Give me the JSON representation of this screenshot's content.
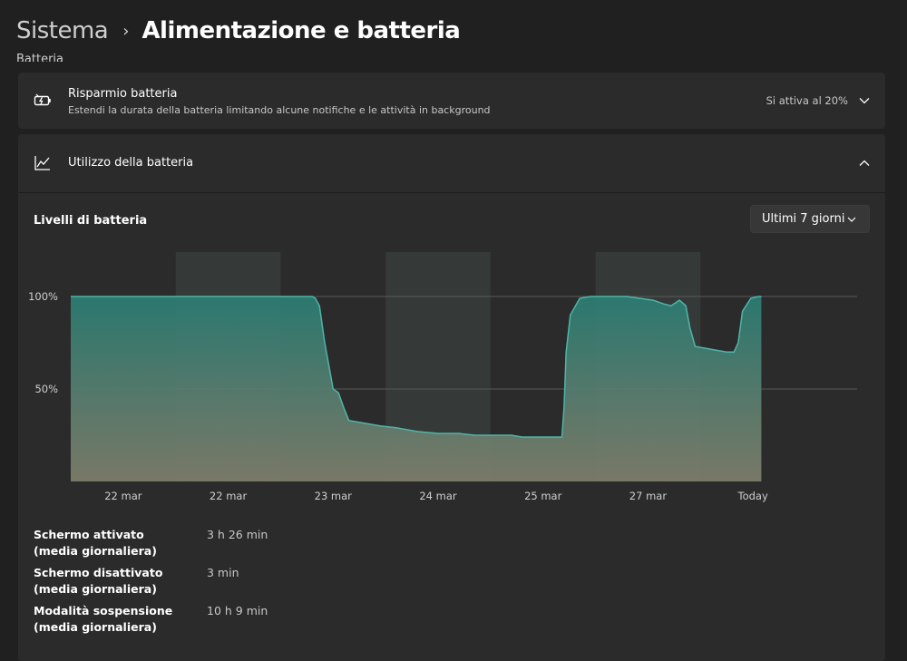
{
  "header": {
    "parent": "Sistema",
    "separator": "›",
    "current": "Alimentazione e batteria"
  },
  "section_label": "Batteria",
  "battery_saver": {
    "icon": "battery-saver-icon",
    "title": "Risparmio batteria",
    "description": "Estendi la durata della batteria limitando alcune notifiche e le attività in background",
    "status": "Si attiva al 20%",
    "expanded": false
  },
  "battery_usage": {
    "icon": "line-chart-icon",
    "title": "Utilizzo della batteria",
    "expanded": true,
    "chart_title": "Livelli di batteria",
    "range_selector": "Ultimi 7 giorni"
  },
  "colors": {
    "background": "#202020",
    "card": "#2b2b2b",
    "accent_line": "#4fb5a8",
    "fill_top": "#2b7e74",
    "fill_bottom": "#7f7e6b",
    "night_band": "#353938"
  },
  "chart_data": {
    "type": "area",
    "x_tick_labels": [
      "22 mar",
      "22 mar",
      "23 mar",
      "24 mar",
      "25 mar",
      "27 mar",
      "Today"
    ],
    "y_tick_labels": [
      "100%",
      "50%"
    ],
    "ylim": [
      0,
      100
    ],
    "x_range": [
      0,
      7
    ],
    "night_bands": [
      [
        1.0,
        2.0
      ],
      [
        3.0,
        4.0
      ],
      [
        5.0,
        6.0
      ]
    ],
    "points": [
      [
        0.0,
        100
      ],
      [
        2.3,
        100
      ],
      [
        2.33,
        99
      ],
      [
        2.37,
        95
      ],
      [
        2.42,
        75
      ],
      [
        2.5,
        50
      ],
      [
        2.55,
        48
      ],
      [
        2.6,
        40
      ],
      [
        2.65,
        33
      ],
      [
        2.75,
        32
      ],
      [
        2.85,
        31
      ],
      [
        2.95,
        30
      ],
      [
        3.1,
        29
      ],
      [
        3.3,
        27
      ],
      [
        3.5,
        26
      ],
      [
        3.7,
        26
      ],
      [
        3.85,
        25
      ],
      [
        4.0,
        25
      ],
      [
        4.2,
        25
      ],
      [
        4.3,
        24
      ],
      [
        4.5,
        24
      ],
      [
        4.68,
        24
      ],
      [
        4.7,
        40
      ],
      [
        4.72,
        70
      ],
      [
        4.76,
        90
      ],
      [
        4.85,
        99
      ],
      [
        4.95,
        100
      ],
      [
        5.15,
        100
      ],
      [
        5.3,
        100
      ],
      [
        5.42,
        99
      ],
      [
        5.55,
        98
      ],
      [
        5.65,
        96
      ],
      [
        5.72,
        95
      ],
      [
        5.8,
        98
      ],
      [
        5.86,
        95
      ],
      [
        5.9,
        83
      ],
      [
        5.95,
        73
      ],
      [
        6.05,
        72
      ],
      [
        6.15,
        71
      ],
      [
        6.25,
        70
      ],
      [
        6.32,
        70
      ],
      [
        6.36,
        75
      ],
      [
        6.4,
        92
      ],
      [
        6.48,
        99
      ],
      [
        6.55,
        100
      ],
      [
        6.58,
        100
      ]
    ],
    "gridlines": [
      100,
      50
    ]
  },
  "stats": [
    {
      "label": "Schermo attivato (media giornaliera)",
      "value": "3 h 26 min"
    },
    {
      "label": "Schermo disattivato (media giornaliera)",
      "value": "3 min"
    },
    {
      "label": "Modalità sospensione (media giornaliera)",
      "value": "10 h 9 min"
    }
  ]
}
